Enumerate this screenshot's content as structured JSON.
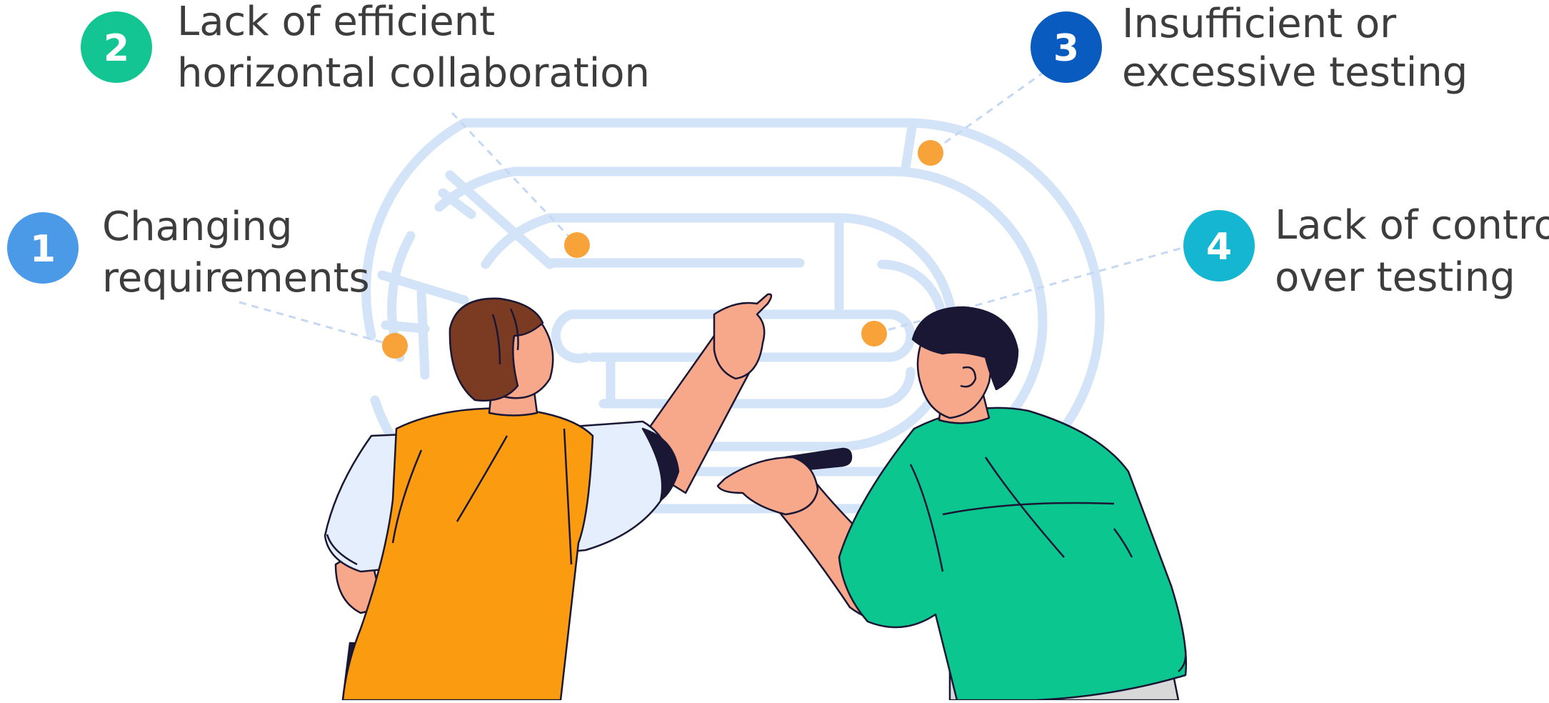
{
  "items": [
    {
      "number": "1",
      "line1": "Changing",
      "line2": "requirements",
      "color": "#4a9ae8"
    },
    {
      "number": "2",
      "line1": "Lack of efficient",
      "line2": "horizontal collaboration",
      "color": "#12c592"
    },
    {
      "number": "3",
      "line1": "Insufficient or",
      "line2": "excessive testing",
      "color": "#0a5bbf"
    },
    {
      "number": "4",
      "line1": "Lack of control",
      "line2": "over testing",
      "color": "#14b6d2"
    }
  ],
  "colors": {
    "maze": "#d3e3f8",
    "dot": "#f7a339",
    "dashed": "#c5d8f3",
    "text": "#3d3d3d",
    "vest": "#fb9b10",
    "shirt": "#0cc690",
    "skin": "#f7a78a",
    "hair_left": "#7b3a22",
    "hair_right": "#1a1735"
  },
  "icons": {
    "maze": "maze-illustration",
    "person_left": "person-pointing-illustration",
    "person_right": "person-with-marker-illustration"
  }
}
